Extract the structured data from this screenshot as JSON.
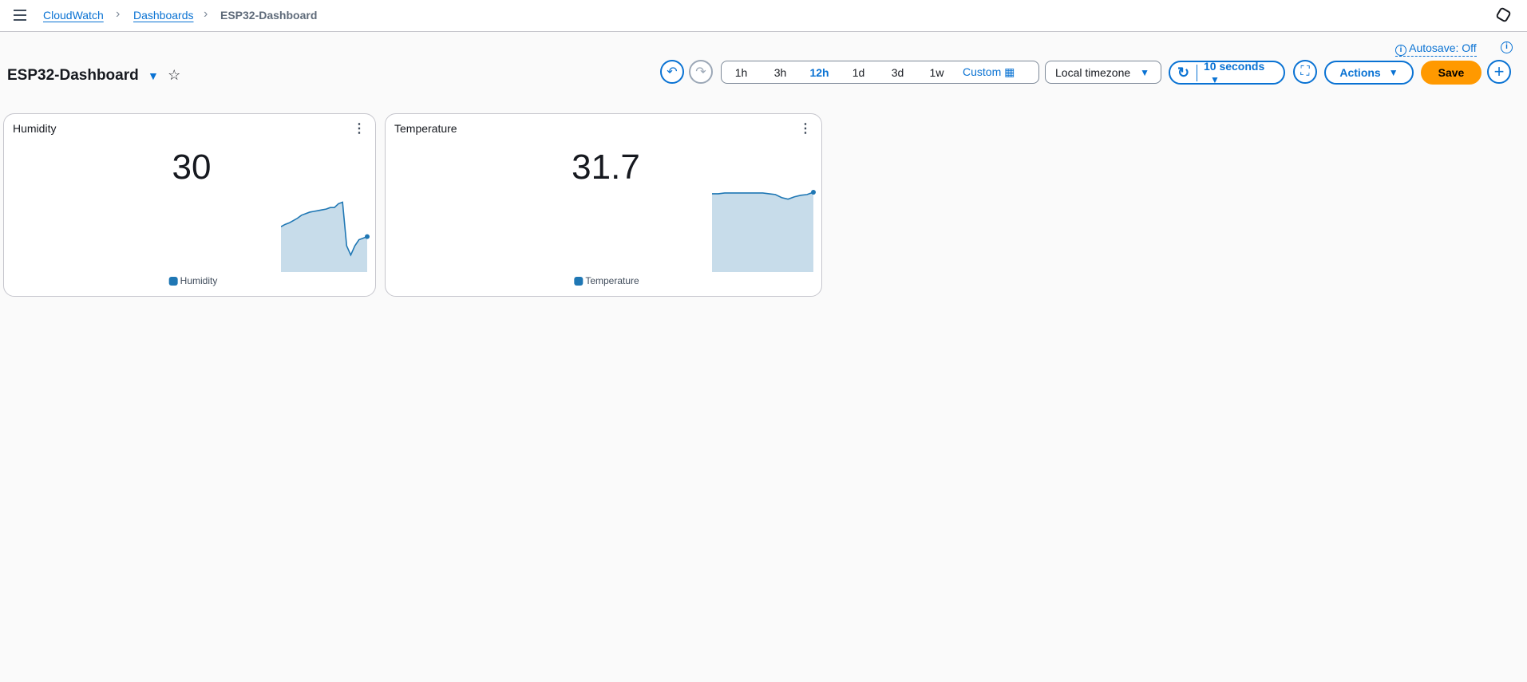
{
  "breadcrumb": {
    "items": [
      "CloudWatch",
      "Dashboards"
    ],
    "current": "ESP32-Dashboard"
  },
  "page": {
    "title": "ESP32-Dashboard",
    "autosave": "Autosave: Off"
  },
  "toolbar": {
    "ranges": [
      "1h",
      "3h",
      "12h",
      "1d",
      "3d",
      "1w"
    ],
    "selected_range": "12h",
    "custom": "Custom",
    "timezone": "Local timezone",
    "refresh": "10 seconds",
    "actions": "Actions",
    "save": "Save"
  },
  "colors": {
    "accent": "#0972d3",
    "save": "#ff9900",
    "series": "#1f77b4"
  },
  "widgets": [
    {
      "title": "Humidity",
      "value": "30",
      "legend": "Humidity",
      "spark": [
        0.55,
        0.58,
        0.6,
        0.63,
        0.66,
        0.7,
        0.72,
        0.74,
        0.75,
        0.76,
        0.77,
        0.78,
        0.8,
        0.8,
        0.85,
        0.87,
        0.3,
        0.18,
        0.3,
        0.38,
        0.4,
        0.42
      ]
    },
    {
      "title": "Temperature",
      "value": "31.7",
      "legend": "Temperature",
      "spark": [
        0.98,
        0.98,
        0.99,
        0.99,
        0.99,
        0.99,
        0.99,
        0.99,
        0.99,
        0.98,
        0.97,
        0.93,
        0.91,
        0.94,
        0.96,
        0.97,
        1.0
      ]
    }
  ]
}
